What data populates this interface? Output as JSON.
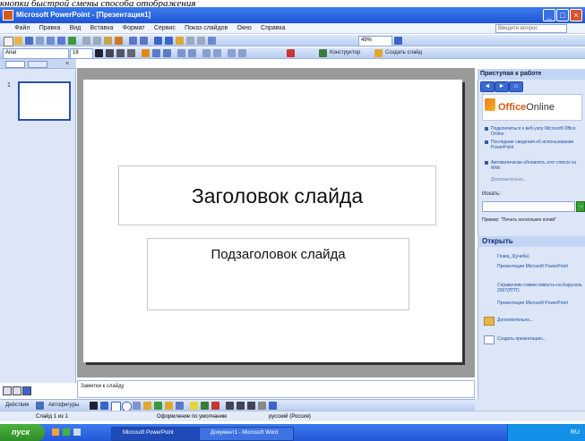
{
  "caption": "кнопки быстрой смены способа отображения",
  "window": {
    "title": "Microsoft PowerPoint - [Презентация1]",
    "min_label": "_",
    "max_label": "□",
    "close_label": "×"
  },
  "menu": {
    "items": [
      "Файл",
      "Правка",
      "Вид",
      "Вставка",
      "Формат",
      "Сервис",
      "Показ слайдов",
      "Окно",
      "Справка"
    ],
    "help_placeholder": "Введите вопрос"
  },
  "toolbar": {
    "zoom": "49%",
    "font": "Arial",
    "font_size": "18",
    "design_label": "Конструктор",
    "new_slide_label": "Создать слайд"
  },
  "slides_pane": {
    "slide_number": "1"
  },
  "slide": {
    "title": "Заголовок слайда",
    "subtitle": "Подзаголовок слайда"
  },
  "notes": {
    "placeholder": "Заметки к слайду"
  },
  "task_pane": {
    "title": "Приступая к работе",
    "office_online_prefix": "Office",
    "office_online_suffix": "Online",
    "links": [
      "Подключиться к веб-узлу Microsoft Office Online",
      "Последние сведения об использовании PowerPoint",
      "Автоматически обновлять этот список из Web"
    ],
    "more_label": "Дополнительно...",
    "search_label": "Искать:",
    "search_go": "→",
    "example": "Пример: \"Печать нескольких копий\"",
    "open_header": "Открыть",
    "open_items": [
      "Глава_3(учебн)",
      "Презентация Microsoft PowerPoint",
      "Справочник-совместимость-на Карусель 2007(ППТ)",
      "Презентация Microsoft PowerPoint"
    ],
    "open_more": "Дополнительно...",
    "create_label": "Создать презентацию..."
  },
  "drawing_toolbar": {
    "actions_label": "Действия",
    "autoshapes_label": "Автофигуры"
  },
  "status": {
    "slide": "Слайд 1 из 1",
    "design": "Оформление по умолчанию",
    "language": "русский (Россия)"
  },
  "taskbar": {
    "start_label": "пуск",
    "buttons": [
      "Microsoft PowerPoint",
      "Документ1 - Microsoft Word"
    ],
    "clock": "RU"
  }
}
